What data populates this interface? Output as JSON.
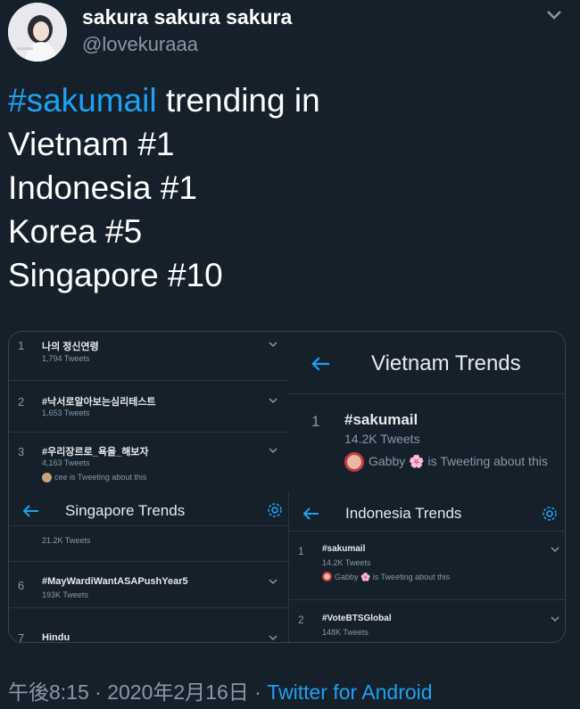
{
  "tweet": {
    "display_name": "sakura sakura sakura",
    "handle": "@lovekuraaa",
    "hashtag": "#sakumail",
    "text_line1_rest": " trending in",
    "text_lines": [
      "Vietnam #1",
      "Indonesia #1",
      "Korea #5",
      "Singapore #10"
    ],
    "timestamp": "午後8:15 · 2020年2月16日 · ",
    "source": "Twitter for Android"
  },
  "korea_panel": {
    "trends": [
      {
        "rank": "1",
        "name": "나의 정신연령",
        "count": "1,794 Tweets"
      },
      {
        "rank": "2",
        "name": "#낙서로알아보는심리테스트",
        "count": "1,653 Tweets"
      },
      {
        "rank": "3",
        "name": "#우리장르로_욕을_해보자",
        "count": "4,163 Tweets",
        "context": "cee is Tweeting about this"
      }
    ]
  },
  "singapore_panel": {
    "title": "Singapore Trends",
    "partial_count": "21.2K Tweets",
    "trends": [
      {
        "rank": "6",
        "name": "#MayWardiWantASAPushYear5",
        "count": "193K Tweets"
      },
      {
        "rank": "7",
        "name": "Hindu"
      }
    ]
  },
  "vietnam_panel": {
    "title": "Vietnam Trends",
    "trend": {
      "rank": "1",
      "name": "#sakumail",
      "count": "14.2K Tweets",
      "context": "Gabby 🌸 is Tweeting about this"
    }
  },
  "indonesia_panel": {
    "title": "Indonesia Trends",
    "trends": [
      {
        "rank": "1",
        "name": "#sakumail",
        "count": "14.2K Tweets",
        "context": "Gabby 🌸 is Tweeting about this"
      },
      {
        "rank": "2",
        "name": "#VoteBTSGlobal",
        "count": "148K Tweets"
      }
    ]
  },
  "colors": {
    "background": "#15202b",
    "accent": "#1da1f2",
    "secondary_text": "#8899a6"
  }
}
